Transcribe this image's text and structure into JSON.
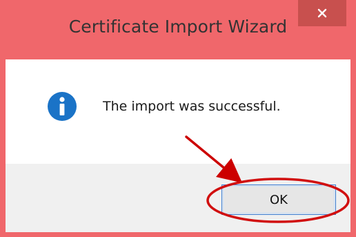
{
  "window": {
    "title": "Certificate Import Wizard"
  },
  "icons": {
    "close": "close-icon",
    "info": "info-icon"
  },
  "message": {
    "text": "The import was successful."
  },
  "buttons": {
    "ok_label": "OK"
  },
  "colors": {
    "titlebar": "#f0676b",
    "close_button": "#c8504e",
    "info_icon": "#1a73c7",
    "annotation": "#cc0000",
    "focus_border": "#3c7fd6"
  }
}
